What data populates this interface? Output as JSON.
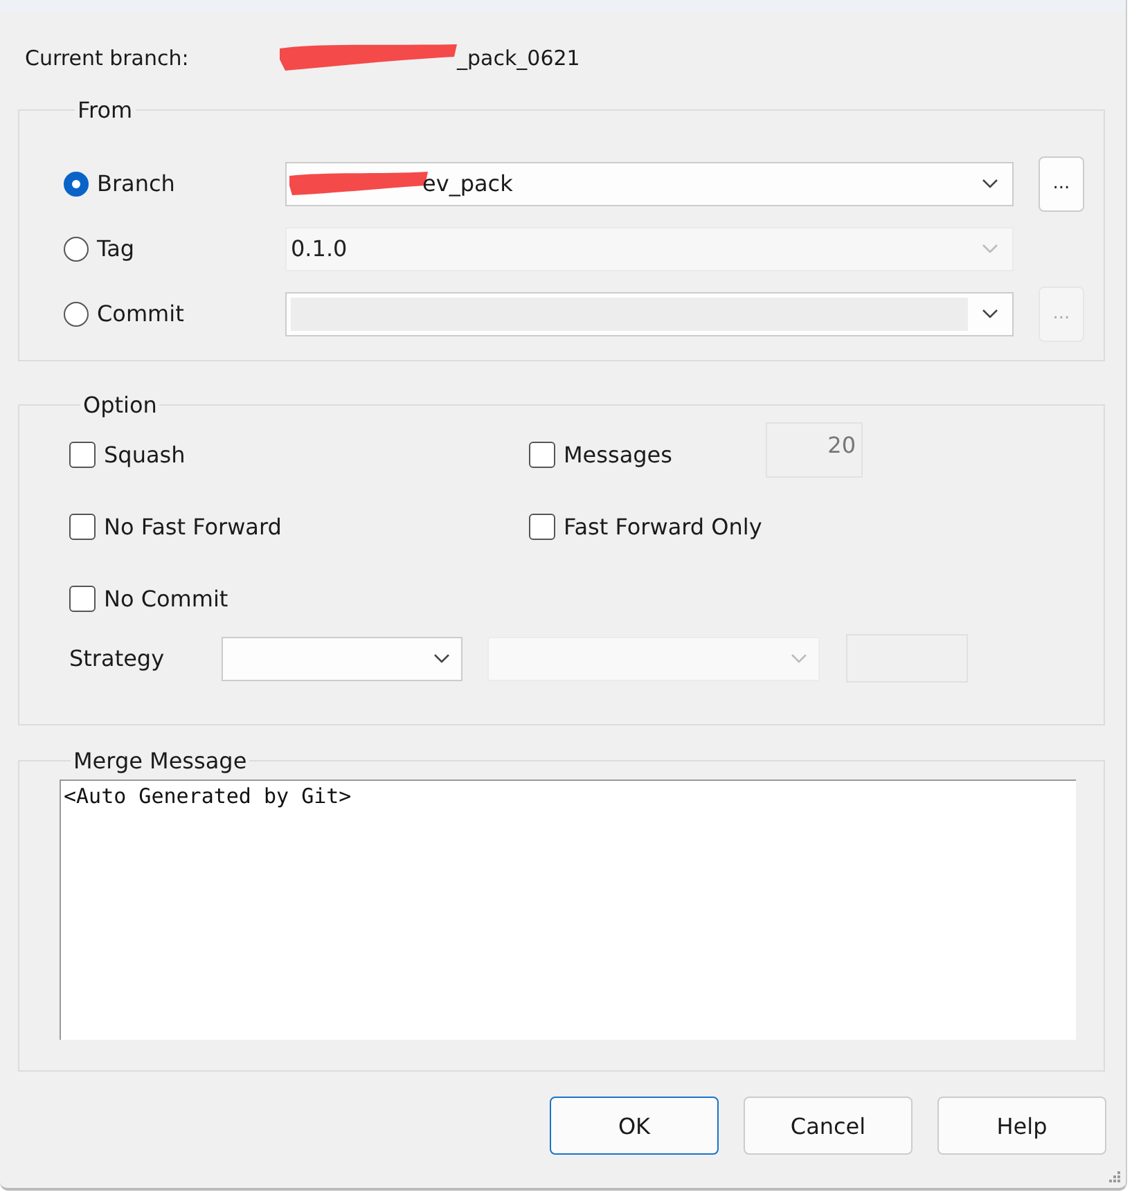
{
  "current_branch": {
    "label": "Current branch:",
    "value": "_pack_0621",
    "redacted": true
  },
  "from": {
    "title": "From",
    "sources": [
      {
        "label": "Branch",
        "selected": true,
        "value": "ev_pack",
        "redacted": true,
        "disabled": false,
        "browse": {
          "label": "...",
          "disabled": false
        }
      },
      {
        "label": "Tag",
        "selected": false,
        "value": "0.1.0",
        "disabled": true
      },
      {
        "label": "Commit",
        "selected": false,
        "disabled": false,
        "browse": {
          "label": "...",
          "disabled": true
        }
      }
    ]
  },
  "options": {
    "title": "Option",
    "left": [
      {
        "label": "Squash",
        "checked": false
      },
      {
        "label": "No Fast Forward",
        "checked": false
      },
      {
        "label": "No Commit",
        "checked": false
      }
    ],
    "right": [
      {
        "label": "Messages",
        "checked": false,
        "count": "20"
      },
      {
        "label": "Fast Forward Only",
        "checked": false
      }
    ],
    "strategy": {
      "label": "Strategy"
    }
  },
  "merge_message": {
    "title": "Merge Message",
    "value": "<Auto Generated by Git>"
  },
  "buttons": [
    {
      "label": "OK",
      "default": true
    },
    {
      "label": "Cancel",
      "default": false
    },
    {
      "label": "Help",
      "default": false
    }
  ]
}
